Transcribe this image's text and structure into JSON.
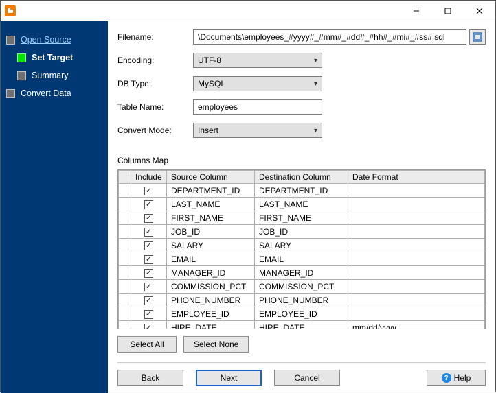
{
  "sidebar": {
    "items": [
      {
        "label": "Open Source",
        "link": true,
        "indent": false,
        "active": false
      },
      {
        "label": "Set Target",
        "link": false,
        "indent": true,
        "active": true,
        "current": true
      },
      {
        "label": "Summary",
        "link": false,
        "indent": true,
        "active": false
      },
      {
        "label": "Convert Data",
        "link": false,
        "indent": false,
        "active": false
      }
    ]
  },
  "form": {
    "filename_label": "Filename:",
    "filename_value": "\\Documents\\employees_#yyyy#_#mm#_#dd#_#hh#_#mi#_#ss#.sql",
    "encoding_label": "Encoding:",
    "encoding_value": "UTF-8",
    "dbtype_label": "DB Type:",
    "dbtype_value": "MySQL",
    "tablename_label": "Table Name:",
    "tablename_value": "employees",
    "convertmode_label": "Convert Mode:",
    "convertmode_value": "Insert"
  },
  "columns_map": {
    "title": "Columns Map",
    "headers": [
      "",
      "Include",
      "Source Column",
      "Destination Column",
      "Date Format"
    ],
    "rows": [
      {
        "include": true,
        "src": "DEPARTMENT_ID",
        "dst": "DEPARTMENT_ID",
        "fmt": ""
      },
      {
        "include": true,
        "src": "LAST_NAME",
        "dst": "LAST_NAME",
        "fmt": ""
      },
      {
        "include": true,
        "src": "FIRST_NAME",
        "dst": "FIRST_NAME",
        "fmt": ""
      },
      {
        "include": true,
        "src": "JOB_ID",
        "dst": "JOB_ID",
        "fmt": ""
      },
      {
        "include": true,
        "src": "SALARY",
        "dst": "SALARY",
        "fmt": ""
      },
      {
        "include": true,
        "src": "EMAIL",
        "dst": "EMAIL",
        "fmt": ""
      },
      {
        "include": true,
        "src": "MANAGER_ID",
        "dst": "MANAGER_ID",
        "fmt": ""
      },
      {
        "include": true,
        "src": "COMMISSION_PCT",
        "dst": "COMMISSION_PCT",
        "fmt": ""
      },
      {
        "include": true,
        "src": "PHONE_NUMBER",
        "dst": "PHONE_NUMBER",
        "fmt": ""
      },
      {
        "include": true,
        "src": "EMPLOYEE_ID",
        "dst": "EMPLOYEE_ID",
        "fmt": ""
      },
      {
        "include": true,
        "src": "HIRE_DATE",
        "dst": "HIRE_DATE",
        "fmt": "mm/dd/yyyy"
      }
    ]
  },
  "buttons": {
    "select_all": "Select All",
    "select_none": "Select None",
    "back": "Back",
    "next": "Next",
    "cancel": "Cancel",
    "help": "Help"
  }
}
